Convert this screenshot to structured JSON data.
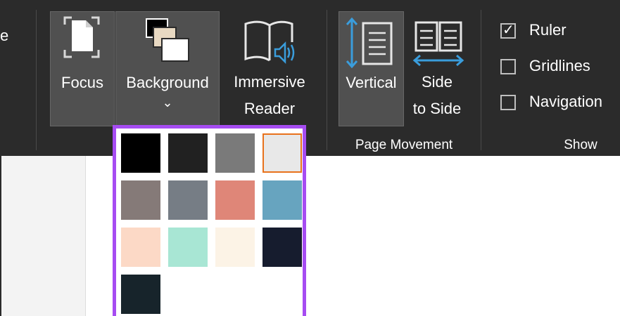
{
  "ribbon": {
    "partial_label": "e",
    "focus": {
      "label": "Focus",
      "icon": "page-focus-icon"
    },
    "background": {
      "label": "Background",
      "chevron": "⌄",
      "icon": "background-color-icon"
    },
    "immersive_reader": {
      "line1": "Immersive",
      "line2": "Reader",
      "icon": "book-speaker-icon"
    },
    "vertical": {
      "label": "Vertical",
      "icon": "vertical-page-movement-icon"
    },
    "side_to_side": {
      "line1": "Side",
      "line2": "to Side",
      "icon": "side-to-side-page-icon"
    },
    "groups": {
      "page_movement": "Page Movement",
      "show": "Show"
    },
    "show": {
      "ruler": {
        "label": "Ruler",
        "checked": true,
        "tick": "✓"
      },
      "gridlines": {
        "label": "Gridlines",
        "checked": false
      },
      "navigation": {
        "label": "Navigation",
        "checked": false
      }
    }
  },
  "background_menu": {
    "selected_index": 3,
    "swatches": [
      {
        "color": "#000000"
      },
      {
        "color": "#212121"
      },
      {
        "color": "#7a7a7a"
      },
      {
        "color": "#e8e8e8"
      },
      {
        "color": "#857a78"
      },
      {
        "color": "#767d85"
      },
      {
        "color": "#df8678"
      },
      {
        "color": "#67a4bf"
      },
      {
        "color": "#fcd9c6"
      },
      {
        "color": "#a8e6d4"
      },
      {
        "color": "#fcf3e6"
      },
      {
        "color": "#161c2e"
      },
      {
        "color": "#17242b"
      }
    ]
  },
  "colors": {
    "ribbon_bg": "#2b2b2b",
    "selected_button": "#505050",
    "menu_border": "#a64cf2",
    "swatch_highlight": "#e8721c",
    "icon_blue": "#3a9ddc"
  }
}
